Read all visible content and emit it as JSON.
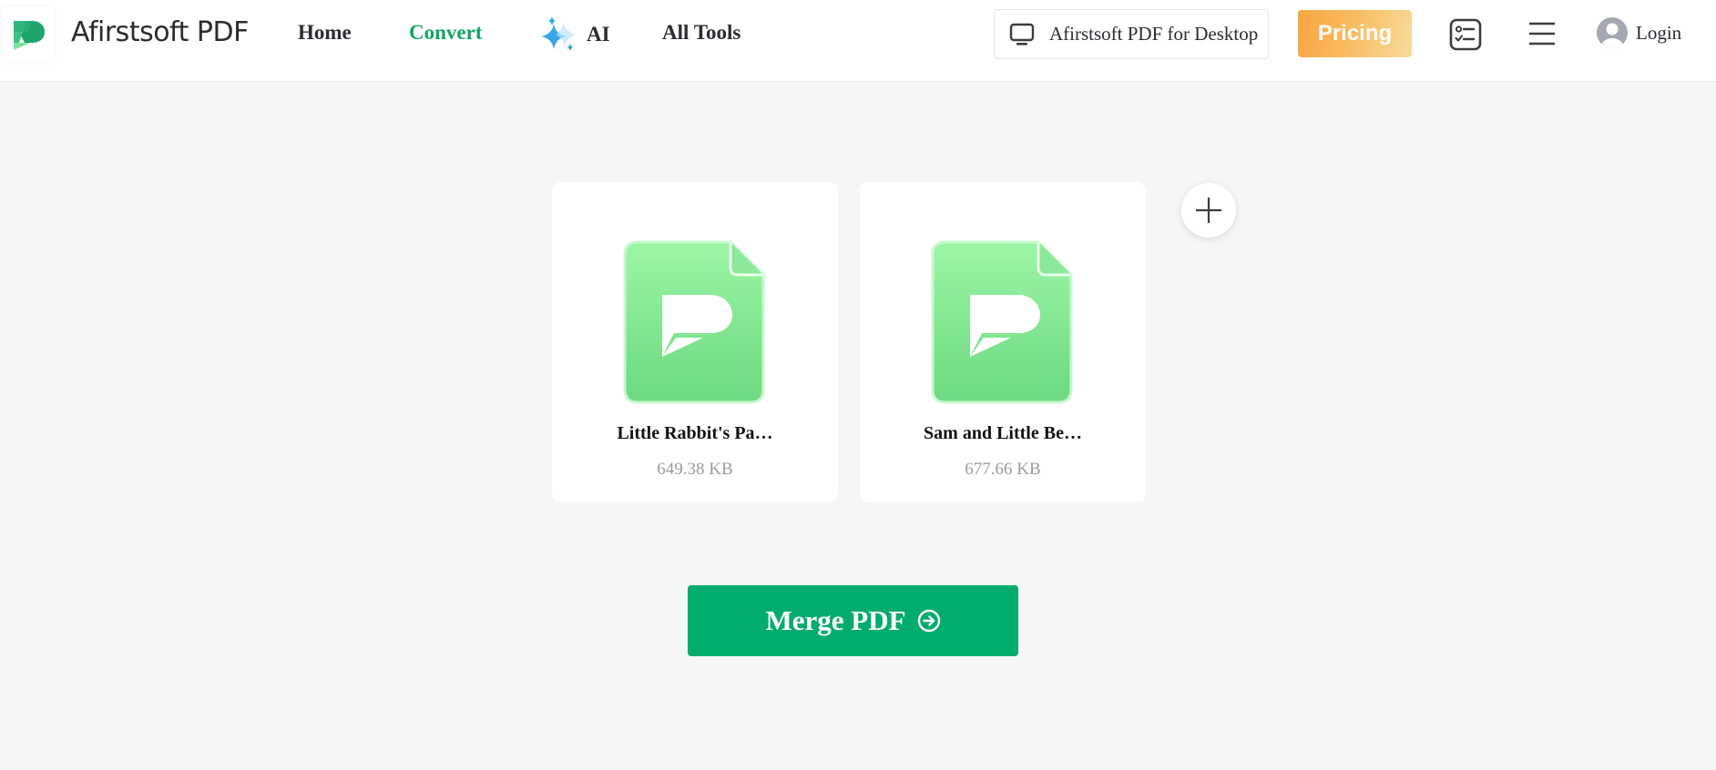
{
  "header": {
    "brand": "Afirstsoft PDF",
    "nav": [
      {
        "label": "Home",
        "active": false
      },
      {
        "label": "Convert",
        "active": true
      },
      {
        "label": "AI",
        "icon": "sparkle-icon",
        "active": false
      },
      {
        "label": "All Tools",
        "active": false
      }
    ],
    "desktop_button": {
      "label": "Afirstsoft PDF for Desktop",
      "icon": "monitor-icon"
    },
    "pricing_button": {
      "label": "Pricing"
    },
    "tasks_icon": "checklist-icon",
    "menu_icon": "hamburger-icon",
    "login": {
      "label": "Login",
      "icon": "avatar-icon"
    }
  },
  "files": [
    {
      "name": "Little Rabbit's Pa…",
      "size": "649.38 KB"
    },
    {
      "name": "Sam and Little Be…",
      "size": "677.66 KB"
    }
  ],
  "add_button": {
    "icon": "plus-icon"
  },
  "merge_button": {
    "label": "Merge PDF",
    "icon": "arrow-circle-right-icon"
  },
  "colors": {
    "brand_green": "#02ac6c",
    "nav_active": "#14a564",
    "pricing_orange": "#f8a440",
    "file_icon_green": "#7fe28f",
    "background": "#f5f6f8"
  }
}
